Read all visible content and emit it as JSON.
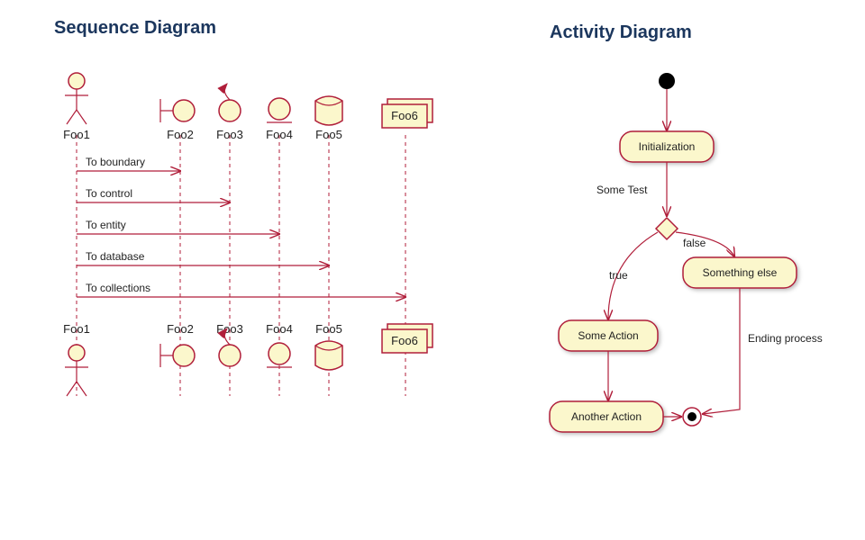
{
  "sequence": {
    "title": "Sequence Diagram",
    "participants": [
      {
        "id": "p1",
        "name": "Foo1",
        "type": "actor"
      },
      {
        "id": "p2",
        "name": "Foo2",
        "type": "boundary"
      },
      {
        "id": "p3",
        "name": "Foo3",
        "type": "control"
      },
      {
        "id": "p4",
        "name": "Foo4",
        "type": "entity"
      },
      {
        "id": "p5",
        "name": "Foo5",
        "type": "database"
      },
      {
        "id": "p6",
        "name": "Foo6",
        "type": "collections"
      }
    ],
    "messages": [
      {
        "from": "p1",
        "to": "p2",
        "label": "To boundary"
      },
      {
        "from": "p1",
        "to": "p3",
        "label": "To control"
      },
      {
        "from": "p1",
        "to": "p4",
        "label": "To entity"
      },
      {
        "from": "p1",
        "to": "p5",
        "label": "To database"
      },
      {
        "from": "p1",
        "to": "p6",
        "label": "To collections"
      }
    ]
  },
  "activity": {
    "title": "Activity Diagram",
    "nodes": [
      {
        "id": "start",
        "type": "start"
      },
      {
        "id": "init",
        "type": "action",
        "label": "Initialization"
      },
      {
        "id": "dec",
        "type": "decision"
      },
      {
        "id": "act1",
        "type": "action",
        "label": "Some Action"
      },
      {
        "id": "act2",
        "type": "action",
        "label": "Another Action"
      },
      {
        "id": "else",
        "type": "action",
        "label": "Something else"
      },
      {
        "id": "end",
        "type": "end"
      }
    ],
    "edges": [
      {
        "from": "start",
        "to": "init",
        "label": ""
      },
      {
        "from": "init",
        "to": "dec",
        "label": "Some Test"
      },
      {
        "from": "dec",
        "to": "act1",
        "label": "true"
      },
      {
        "from": "dec",
        "to": "else",
        "label": "false"
      },
      {
        "from": "act1",
        "to": "act2",
        "label": ""
      },
      {
        "from": "act2",
        "to": "end",
        "label": ""
      },
      {
        "from": "else",
        "to": "end",
        "label": "Ending process"
      }
    ]
  }
}
